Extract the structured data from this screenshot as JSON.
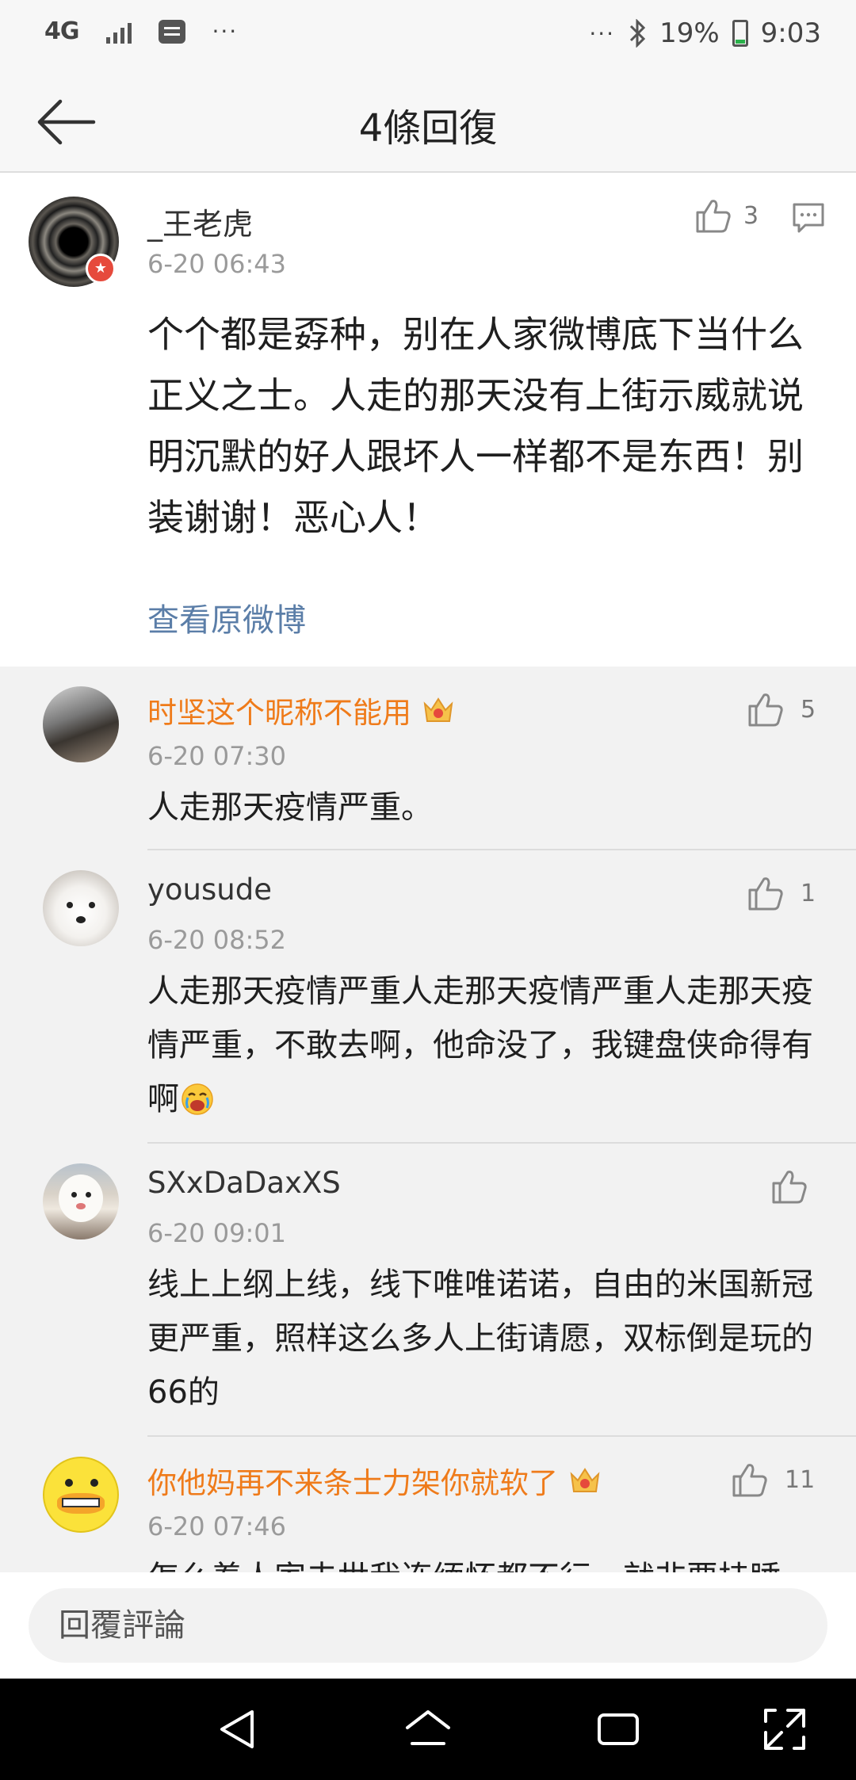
{
  "status_bar": {
    "network": "4G",
    "extra_dots": "···",
    "right_dots": "···",
    "battery": "19%",
    "time": "9:03"
  },
  "header": {
    "title": "4條回復"
  },
  "main_post": {
    "username": "_王老虎",
    "time": "6-20 06:43",
    "likes": "3",
    "text": "个个都是孬种，别在人家微博底下当什么正义之士。人走的那天没有上街示威就说明沉默的好人跟坏人一样都不是东西！别装谢谢！恶心人！",
    "view_original": "查看原微博"
  },
  "replies": [
    {
      "username": "时坚这个昵称不能用",
      "time": "6-20 07:30",
      "likes": "5",
      "text": "人走那天疫情严重。"
    },
    {
      "username": "yousude",
      "time": "6-20 08:52",
      "likes": "1",
      "text": "人走那天疫情严重人走那天疫情严重人走那天疫情严重，不敢去啊，他命没了，我键盘侠命得有啊"
    },
    {
      "username": "SXxDaDaxXS",
      "time": "6-20 09:01",
      "likes": "",
      "text": "线上上纲上线，线下唯唯诺诺，自由的米国新冠更严重，照样这么多人上街请愿，双标倒是玩的66的"
    },
    {
      "username": "你他妈再不来条士力架你就软了",
      "time": "6-20 07:46",
      "likes": "11",
      "text": "怎么着人家去世我连缅怀都不行，就非要挂睡"
    }
  ],
  "input": {
    "placeholder": "回覆評論"
  },
  "colors": {
    "accent_orange": "#ef7b1a",
    "link_blue": "#5b7ea8",
    "battery_green": "#2ab04a",
    "badge_red": "#e64a3c"
  }
}
